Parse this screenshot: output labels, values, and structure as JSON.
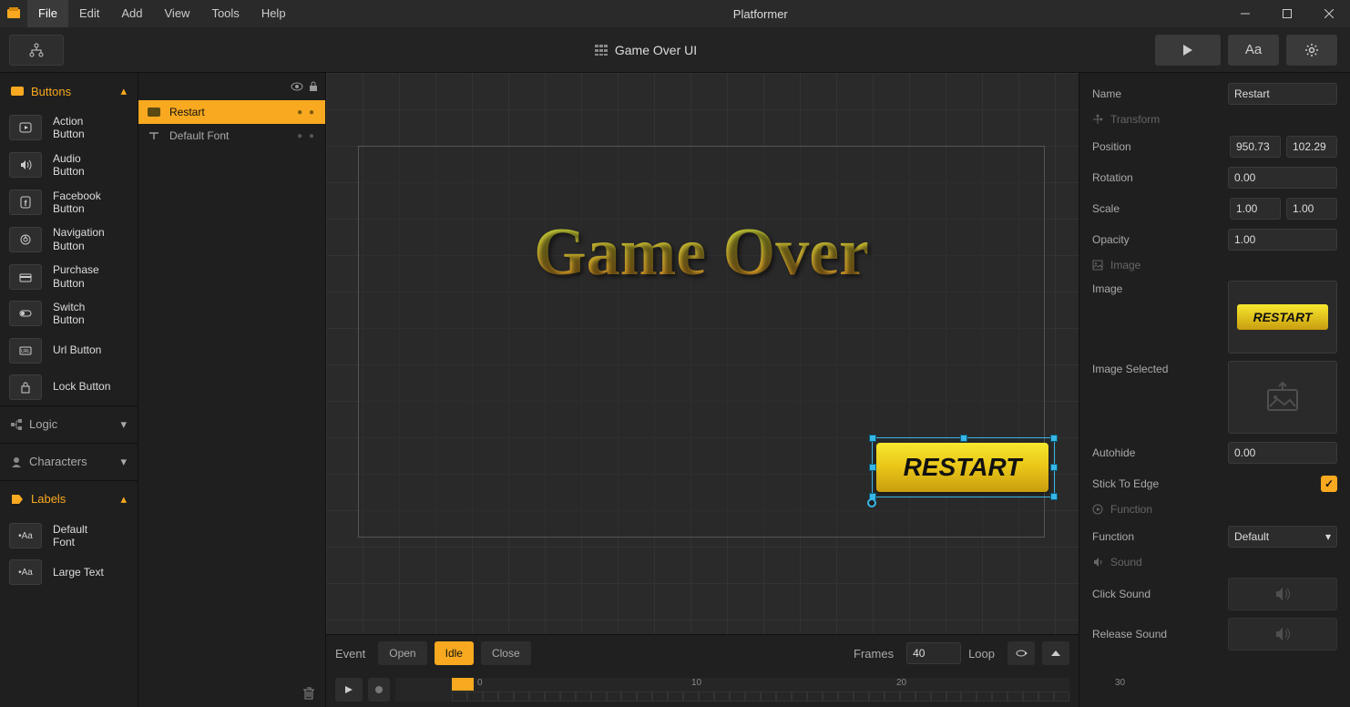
{
  "window": {
    "title": "Platformer"
  },
  "menu": {
    "items": [
      "File",
      "Edit",
      "Add",
      "View",
      "Tools",
      "Help"
    ],
    "active_index": 0
  },
  "scene_title": "Game Over UI",
  "left": {
    "buttons_header": "Buttons",
    "components": [
      {
        "label": "Action\nButton",
        "icon": "action"
      },
      {
        "label": "Audio\nButton",
        "icon": "audio"
      },
      {
        "label": "Facebook\nButton",
        "icon": "facebook"
      },
      {
        "label": "Navigation\nButton",
        "icon": "navigation"
      },
      {
        "label": "Purchase\nButton",
        "icon": "purchase"
      },
      {
        "label": "Switch\nButton",
        "icon": "switch"
      },
      {
        "label": "Url Button",
        "icon": "url"
      },
      {
        "label": "Lock Button",
        "icon": "lock"
      }
    ],
    "logic_header": "Logic",
    "characters_header": "Characters",
    "labels_header": "Labels",
    "label_components": [
      {
        "label": "Default\nFont"
      },
      {
        "label": "Large Text"
      }
    ]
  },
  "hierarchy": {
    "items": [
      {
        "label": "Restart",
        "selected": true
      },
      {
        "label": "Default Font",
        "selected": false
      }
    ]
  },
  "canvas": {
    "game_over_text": "Game Over",
    "restart_text": "RESTART"
  },
  "timeline": {
    "event_label": "Event",
    "tabs": [
      "Open",
      "Idle",
      "Close"
    ],
    "active_tab": 1,
    "frames_label": "Frames",
    "frames_value": "40",
    "loop_label": "Loop",
    "ticks": [
      "0",
      "10",
      "20",
      "30"
    ]
  },
  "inspector": {
    "name_label": "Name",
    "name_value": "Restart",
    "transform_header": "Transform",
    "position_label": "Position",
    "position_x": "950.73",
    "position_y": "102.29",
    "rotation_label": "Rotation",
    "rotation_value": "0.00",
    "scale_label": "Scale",
    "scale_x": "1.00",
    "scale_y": "1.00",
    "opacity_label": "Opacity",
    "opacity_value": "1.00",
    "image_header": "Image",
    "image_label": "Image",
    "image_selected_label": "Image Selected",
    "preview_text": "RESTART",
    "autohide_label": "Autohide",
    "autohide_value": "0.00",
    "stick_label": "Stick To Edge",
    "function_header": "Function",
    "function_label": "Function",
    "function_value": "Default",
    "sound_header": "Sound",
    "click_sound_label": "Click Sound",
    "release_sound_label": "Release Sound"
  }
}
